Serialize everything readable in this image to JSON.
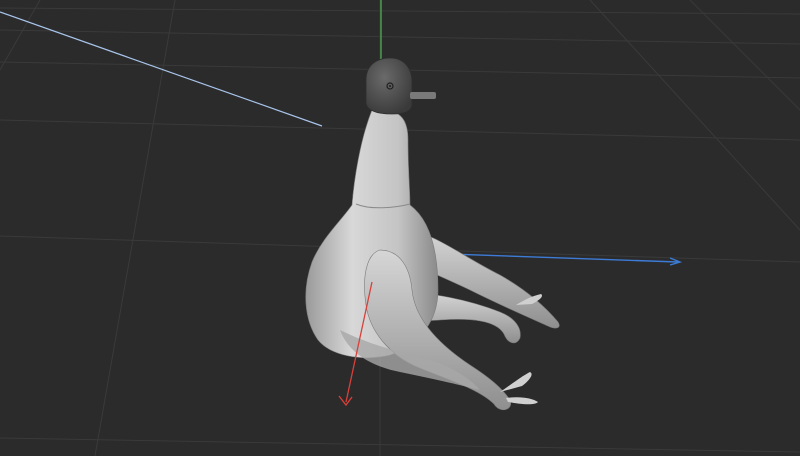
{
  "viewport": {
    "background": "#2b2b2b",
    "grid_color": "#3a3a3a",
    "axis_colors": {
      "x": "#3d7bd6",
      "y": "#4caf50",
      "z": "#d9403a",
      "view_line": "#a8c4ea"
    }
  },
  "model": {
    "body_color": "#c9c9c9",
    "head_color": "#4a4a4a",
    "shadow_color": "#8e8e8e"
  }
}
